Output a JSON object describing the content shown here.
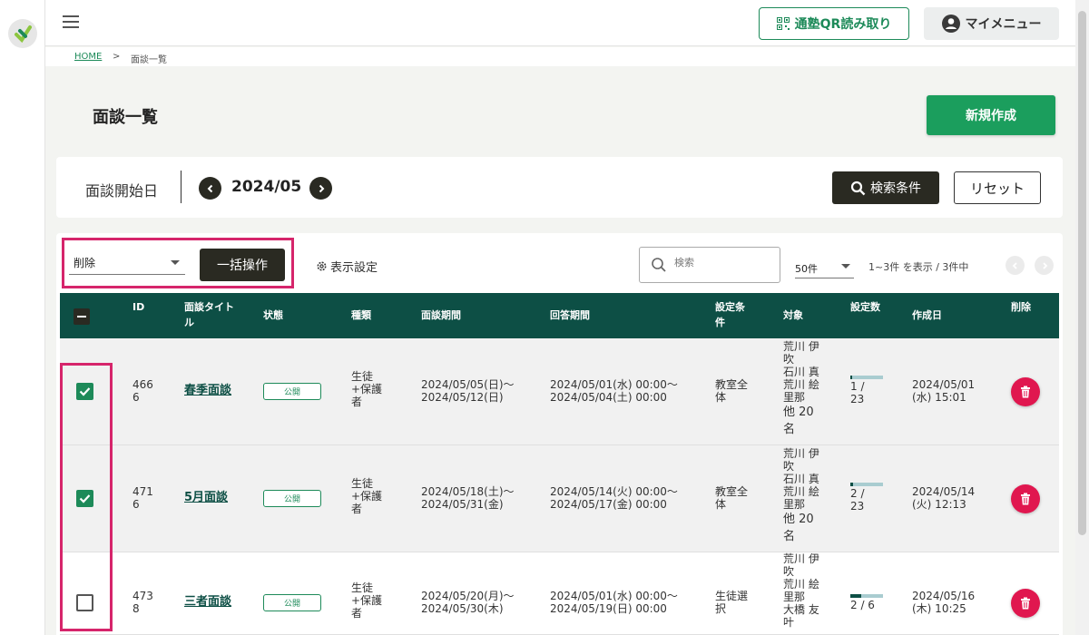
{
  "header": {
    "qr_button": "通塾QR読み取り",
    "my_menu": "マイメニュー"
  },
  "breadcrumb": {
    "home": "HOME",
    "separator": ">",
    "current": "面談一覧"
  },
  "page": {
    "title": "面談一覧",
    "new_button": "新規作成"
  },
  "filter": {
    "label": "面談開始日",
    "month": "2024/05",
    "search_button": "検索条件",
    "reset_button": "リセット"
  },
  "toolbar": {
    "bulk_select_value": "削除",
    "bulk_button": "一括操作",
    "display_settings": "表示設定",
    "search_placeholder": "検索",
    "per_page": "50件",
    "count_text": "1~3件 を表示 / 3件中"
  },
  "table": {
    "headers": {
      "id": "ID",
      "title": "面談タイトル",
      "status": "状態",
      "kind": "種類",
      "period": "面談期間",
      "answer": "回答期間",
      "condition": "設定条件",
      "target": "対象",
      "count": "設定数",
      "created": "作成日",
      "delete": "削除"
    },
    "rows": [
      {
        "checked": true,
        "id": "4666",
        "title": "春季面談",
        "status": "公開",
        "kind": "生徒+保護者",
        "period_start": "2024/05/05(日)～",
        "period_end": "2024/05/12(日)",
        "answer_start": "2024/05/01(水) 00:00～",
        "answer_end": "2024/05/04(土) 00:00",
        "condition": "教室全体",
        "targets": [
          "荒川 伊吹",
          "石川 真",
          "荒川 絵里那"
        ],
        "targets_more": "他 20 名",
        "count_text": "1 / 23",
        "progress": 0.0435,
        "created_date": "2024/05/01",
        "created_time": "(水) 15:01"
      },
      {
        "checked": true,
        "id": "4716",
        "title": "5月面談",
        "status": "公開",
        "kind": "生徒+保護者",
        "period_start": "2024/05/18(土)～",
        "period_end": "2024/05/31(金)",
        "answer_start": "2024/05/14(火) 00:00～",
        "answer_end": "2024/05/17(金) 00:00",
        "condition": "教室全体",
        "targets": [
          "荒川 伊吹",
          "石川 真",
          "荒川 絵里那"
        ],
        "targets_more": "他 20 名",
        "count_text": "2 / 23",
        "progress": 0.087,
        "created_date": "2024/05/14",
        "created_time": "(火) 12:13"
      },
      {
        "checked": false,
        "id": "4738",
        "title": "三者面談",
        "status": "公開",
        "kind": "生徒+保護者",
        "period_start": "2024/05/20(月)～",
        "period_end": "2024/05/30(木)",
        "answer_start": "2024/05/01(水) 00:00～",
        "answer_end": "2024/05/19(日) 00:00",
        "condition": "生徒選択",
        "targets": [
          "荒川 伊吹",
          "荒川 絵里那",
          "大橋 友叶"
        ],
        "targets_more": "",
        "count_text": "2 / 6",
        "progress": 0.333,
        "created_date": "2024/05/16",
        "created_time": "(木) 10:25"
      }
    ]
  },
  "colors": {
    "brand_green": "#1b9e5d",
    "table_header": "#0d4f45",
    "highlight": "#d6256b",
    "delete_red": "#e0174f"
  }
}
